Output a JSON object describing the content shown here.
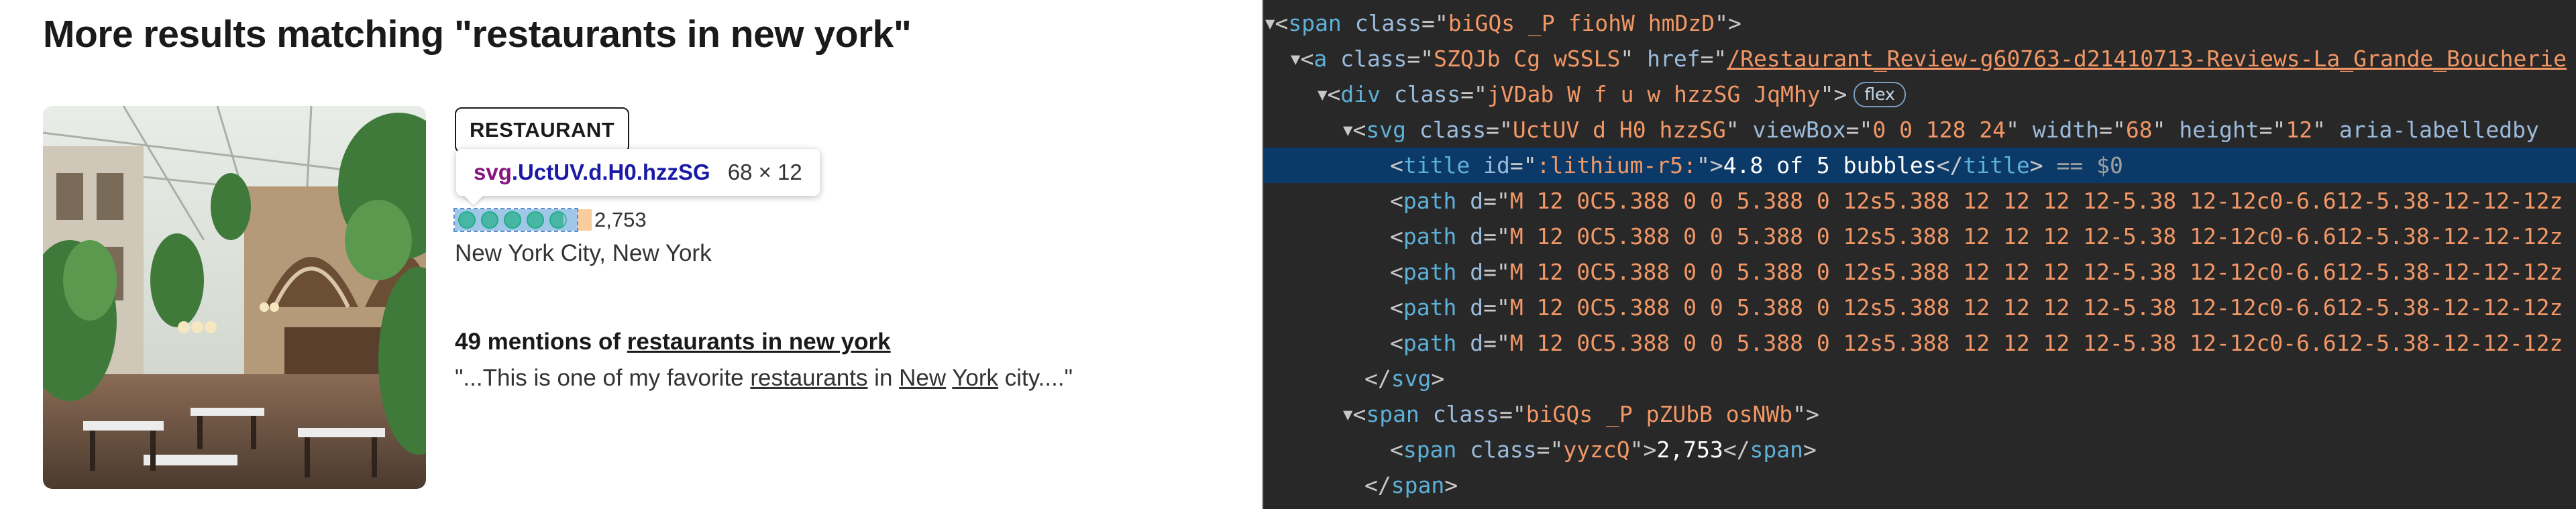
{
  "page": {
    "heading": "More results matching \"restaurants in new york\"",
    "category": "RESTAURANT",
    "tooltip": {
      "tag": "svg",
      "class": ".UctUV.d.H0.hzzSG",
      "size": "68 × 12"
    },
    "rating_value": 4.8,
    "rating_max": 5,
    "review_count": "2,753",
    "location": "New York City, New York",
    "mentions_count": "49 mentions of",
    "mentions_link": "restaurants in new york",
    "quote": {
      "open": "\"...This is one of my favorite ",
      "w1": "restaurants",
      "in": " in ",
      "w2": "New",
      "sp": " ",
      "w3": "York",
      "close": " city....\""
    }
  },
  "devtools": {
    "lines": {
      "l1": {
        "tag": "span",
        "attr": "class",
        "val": "biGQs _P fiohW hmDzD"
      },
      "l2": {
        "tag": "a",
        "attr1": "class",
        "val1": "SZQJb Cg wSSLS",
        "attr2": "href",
        "val2": "/Restaurant_Review-g60763-d21410713-Reviews-La_Grande_Boucherie"
      },
      "l3": {
        "tag": "div",
        "attr": "class",
        "val": "jVDab W f u w hzzSG JqMhy",
        "badge": "flex"
      },
      "l4": {
        "tag": "svg",
        "attr1": "class",
        "val1": "UctUV d H0 hzzSG",
        "attr2": "viewBox",
        "val2": "0 0 128 24",
        "attr3": "width",
        "val3": "68",
        "attr4": "height",
        "val4": "12",
        "attr5": "aria-labelledby"
      },
      "l5": {
        "tag": "title",
        "attr": "id",
        "val": ":lithium-r5:",
        "text": "4.8 of 5 bubbles",
        "eq": "== $0"
      },
      "path": {
        "tag": "path",
        "attr": "d",
        "val": "M 12 0C5.388 0 0 5.388 0 12s5.388 12 12 12 12-5.38 12-12c0-6.612-5.38-12-12-12z"
      },
      "close_svg": "svg",
      "l11": {
        "tag": "span",
        "attr": "class",
        "val": "biGQs _P pZUbB osNWb"
      },
      "l12": {
        "tag": "span",
        "attr": "class",
        "val": "yyzcQ",
        "text": "2,753"
      },
      "close_span": "span"
    }
  },
  "colors": {
    "bubble_fill": "#00aa6c",
    "selection_bg": "#0b3a69",
    "focus_ring": "#6ed39a"
  }
}
